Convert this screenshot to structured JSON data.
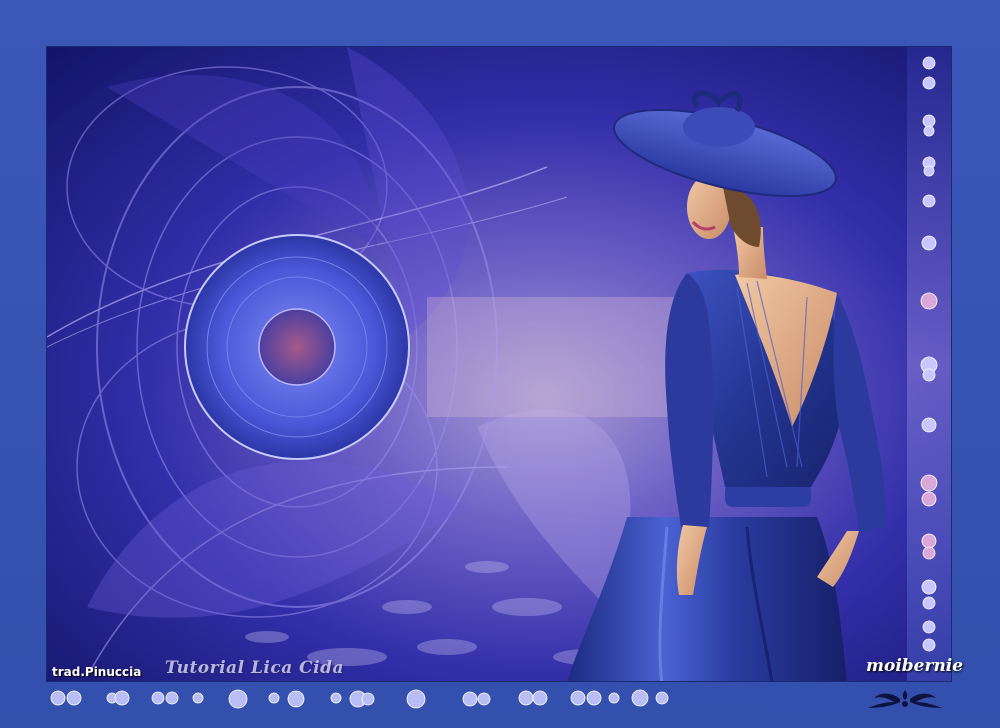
{
  "image": {
    "subject": "woman-in-blue-dress-and-wide-brimmed-hat",
    "palette": {
      "border": "#3a55b4",
      "deep_blue": "#1c1f8a",
      "violet": "#6a52d6",
      "lavender": "#b9a8e6",
      "skin": "#e8b48e",
      "dress": "#2e3f9a"
    }
  },
  "credits": {
    "translator": "trad.Pinuccia",
    "tutorial": "Tutorial Lica Cida",
    "artist_signature": "moibernie"
  },
  "decorations": {
    "bottom_beads_icon": "bead-icon",
    "side_beads_icon": "bead-icon",
    "ornament_icon": "flourish-ornament-icon"
  }
}
